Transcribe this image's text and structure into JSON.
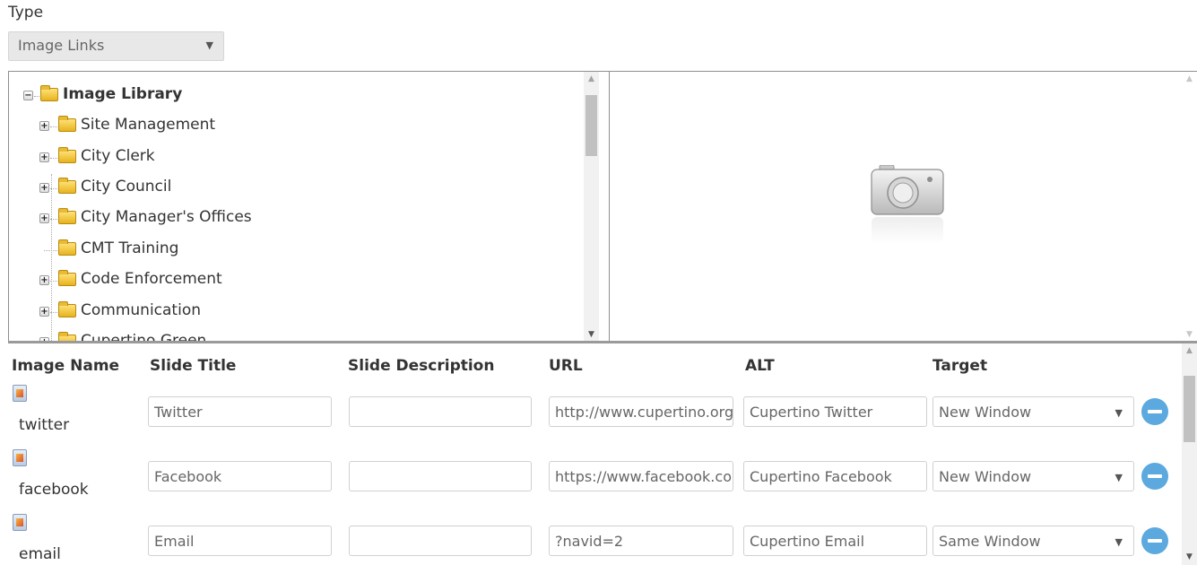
{
  "type_field": {
    "label": "Type",
    "selected": "Image Links"
  },
  "tree": {
    "root": "Image Library",
    "items": [
      {
        "label": "Site Management",
        "expandable": true
      },
      {
        "label": "City Clerk",
        "expandable": true
      },
      {
        "label": "City Council",
        "expandable": true
      },
      {
        "label": "City Manager's Offices",
        "expandable": true
      },
      {
        "label": "CMT Training",
        "expandable": false
      },
      {
        "label": "Code Enforcement",
        "expandable": true
      },
      {
        "label": "Communication",
        "expandable": true
      },
      {
        "label": "Cupertino Green",
        "expandable": true
      }
    ]
  },
  "preview": {
    "icon": "camera-icon"
  },
  "grid": {
    "headers": {
      "image_name": "Image Name",
      "slide_title": "Slide Title",
      "slide_description": "Slide Description",
      "url": "URL",
      "alt": "ALT",
      "target": "Target"
    },
    "rows": [
      {
        "image_name": "twitter",
        "slide_title": "Twitter",
        "slide_description": "",
        "url": "http://www.cupertino.org/twitter",
        "alt": "Cupertino Twitter",
        "target": "New Window"
      },
      {
        "image_name": "facebook",
        "slide_title": "Facebook",
        "slide_description": "",
        "url": "https://www.facebook.com/CityofCupertino",
        "alt": "Cupertino Facebook",
        "target": "New Window"
      },
      {
        "image_name": "email",
        "slide_title": "Email",
        "slide_description": "",
        "url": "?navid=2",
        "alt": "Cupertino Email",
        "target": "Same Window"
      }
    ]
  },
  "colors": {
    "accent": "#5ba9de",
    "folder": "#e7b31d",
    "border": "#8f8f8f"
  }
}
